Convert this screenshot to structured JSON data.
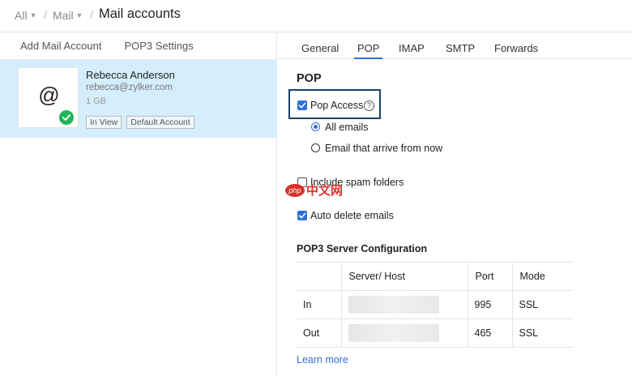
{
  "breadcrumb": {
    "items": [
      "All",
      "Mail"
    ],
    "title": "Mail accounts"
  },
  "left_tabs": [
    "Add Mail Account",
    "POP3 Settings"
  ],
  "account": {
    "avatar_symbol": "@",
    "name": "Rebecca Anderson",
    "email": "rebecca@zylker.com",
    "size": "1 GB",
    "badges": [
      "In View",
      "Default Account"
    ]
  },
  "tabs": [
    {
      "label": "General",
      "active": false
    },
    {
      "label": "POP",
      "active": true
    },
    {
      "label": "IMAP",
      "active": false
    },
    {
      "label": "SMTP",
      "active": false
    },
    {
      "label": "Forwards",
      "active": false
    }
  ],
  "pop": {
    "section_title": "POP",
    "pop_access": {
      "label": "Pop Access",
      "checked": true,
      "help_symbol": "?"
    },
    "radio_options": [
      {
        "label": "All emails",
        "selected": true
      },
      {
        "label": "Email that arrive from now",
        "selected": false
      }
    ],
    "include_spam": {
      "label": "Include spam folders",
      "checked": false
    },
    "auto_delete": {
      "label": "Auto delete emails",
      "checked": true
    }
  },
  "config": {
    "title": "POP3 Server Configuration",
    "headers": [
      "",
      "Server/ Host",
      "Port",
      "Mode"
    ],
    "rows": [
      {
        "type": "In",
        "port": "995",
        "mode": "SSL"
      },
      {
        "type": "Out",
        "port": "465",
        "mode": "SSL"
      }
    ],
    "learn_more": "Learn more"
  },
  "watermark": {
    "badge": "php",
    "text": "中文网"
  },
  "colors": {
    "accent": "#2f6fd6",
    "selected_row": "#d5eefb",
    "success": "#21b45a",
    "focus_outline": "#1c3f70"
  }
}
